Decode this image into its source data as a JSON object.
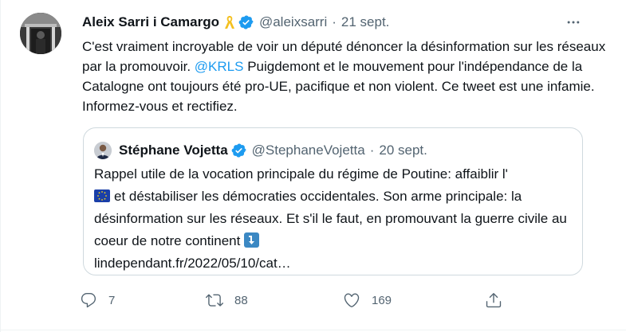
{
  "tweet": {
    "author_name": "Aleix Sarri i Camargo",
    "author_handle": "@aleixsarri",
    "separator": "·",
    "date": "21 sept.",
    "text_before_mention": "C'est vraiment incroyable de voir un député dénoncer la désinformation sur les réseaux par la promouvoir. ",
    "mention": "@KRLS",
    "text_after_mention": " Puigdemont et le mouvement pour l'indépendance de la Catalogne ont toujours été pro-UE, pacifique et non violent. Ce tweet est une infamie. Informez-vous et rectifiez."
  },
  "quoted_tweet": {
    "author_name": "Stéphane Vojetta",
    "author_handle": "@StephaneVojetta",
    "separator": "·",
    "date": "20 sept.",
    "text_part1": "Rappel utile de la vocation principale du régime de Poutine: affaiblir l'",
    "text_part2": "et déstabiliser les démocraties occidentales. Son arme principale: la désinformation sur les réseaux. Et s'il le faut, en promouvant la guerre civile au coeur de notre continent",
    "link": "lindependant.fr/2022/05/10/cat…"
  },
  "actions": {
    "reply_count": "7",
    "retweet_count": "88",
    "like_count": "169"
  },
  "colors": {
    "accent": "#1d9bf0",
    "secondary_text": "#536471",
    "border": "#cfd9de",
    "ribbon": "#f4c020"
  },
  "icons": {
    "ribbon": "yellow-ribbon-icon",
    "verified": "verified-badge-icon",
    "more": "more-icon",
    "eu_flag": "eu-flag-icon",
    "arrow": "arrow-down-emoji-icon",
    "reply": "reply-icon",
    "retweet": "retweet-icon",
    "like": "heart-icon",
    "share": "share-icon"
  }
}
